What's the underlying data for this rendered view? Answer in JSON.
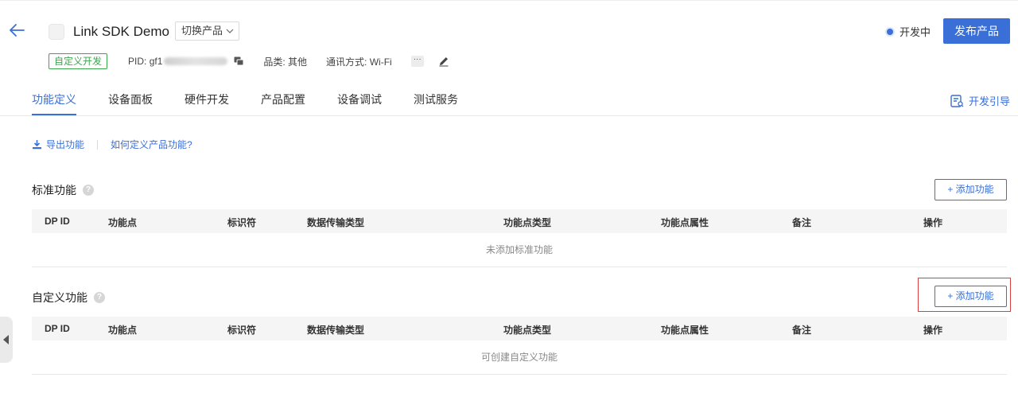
{
  "header": {
    "product_name": "Link SDK Demo",
    "switch_label": "切换产品",
    "status": "开发中",
    "publish_label": "发布产品"
  },
  "meta": {
    "badge": "自定义开发",
    "pid_label": "PID: gf1",
    "category": "品类: 其他",
    "comm": "通讯方式: Wi-Fi",
    "more": "···"
  },
  "tabs": [
    "功能定义",
    "设备面板",
    "硬件开发",
    "产品配置",
    "设备调试",
    "测试服务"
  ],
  "guide_label": "开发引导",
  "actions": {
    "export": "导出功能",
    "howto": "如何定义产品功能?"
  },
  "columns": [
    "DP ID",
    "功能点",
    "标识符",
    "数据传输类型",
    "功能点类型",
    "功能点属性",
    "备注",
    "操作"
  ],
  "standard": {
    "title": "标准功能",
    "add_label": "+ 添加功能",
    "empty": "未添加标准功能"
  },
  "custom": {
    "title": "自定义功能",
    "add_label": "+ 添加功能",
    "empty": "可创建自定义功能"
  },
  "colors": {
    "accent": "#3a6fd8",
    "badge": "#3ca64b",
    "highlight": "#d94040"
  }
}
